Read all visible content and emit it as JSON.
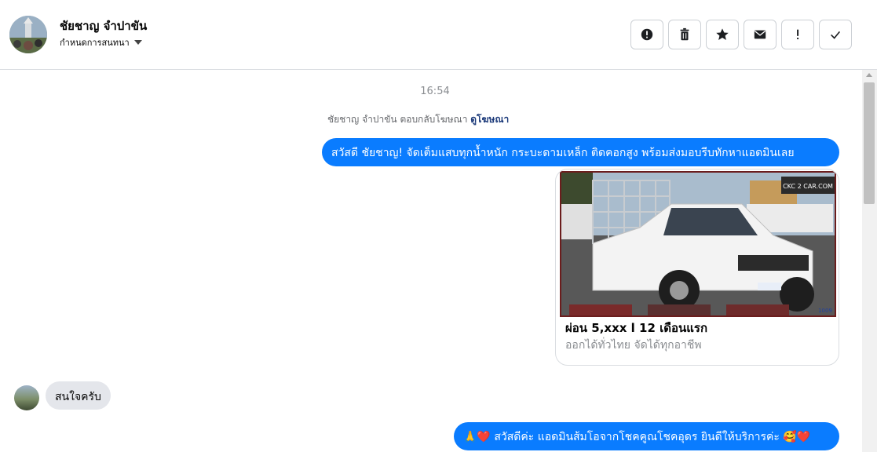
{
  "header": {
    "name": "ชัยชาญ จำปาขัน",
    "subtitle": "กำหนดการสนทนา",
    "actions": [
      {
        "icon": "alert-circle-icon"
      },
      {
        "icon": "trash-icon"
      },
      {
        "icon": "star-icon"
      },
      {
        "icon": "envelope-icon"
      },
      {
        "icon": "exclamation-icon"
      },
      {
        "icon": "check-icon"
      }
    ]
  },
  "thread": {
    "timestamp": "16:54",
    "reply_note": "ชัยชาญ จำปาขัน ตอบกลับโฆษณา",
    "reply_link": "ดูโฆษณา",
    "messages": [
      {
        "direction": "out",
        "text": "สวัสดี ชัยชาญ! จัดเต็มแสบทุกน้ำหนัก กระบะดามเหล็ก ติดคอกสูง พร้อมส่งมอบรีบทักหาแอดมินเลย"
      },
      {
        "direction": "in",
        "text": "สนใจครับ"
      },
      {
        "direction": "out",
        "text": "🙏❤️ สวัสดีค่ะ แอดมินส้มโอจากโชคคูณโชคอุดร ยินดีให้บริการค่ะ 🥰❤️"
      }
    ],
    "ad_card": {
      "title": "ผ่อน 5,xxx l 12 เดือนแรก",
      "subtitle": "ออกได้ทั่วไทย จัดได้ทุกอาชีพ",
      "image_logo": "CKC 2 CAR.COM",
      "image_corner": "1009"
    }
  },
  "colors": {
    "outgoing_bubble": "#0a7cff",
    "incoming_bubble": "#e4e6eb",
    "link": "#1c3a7a"
  }
}
